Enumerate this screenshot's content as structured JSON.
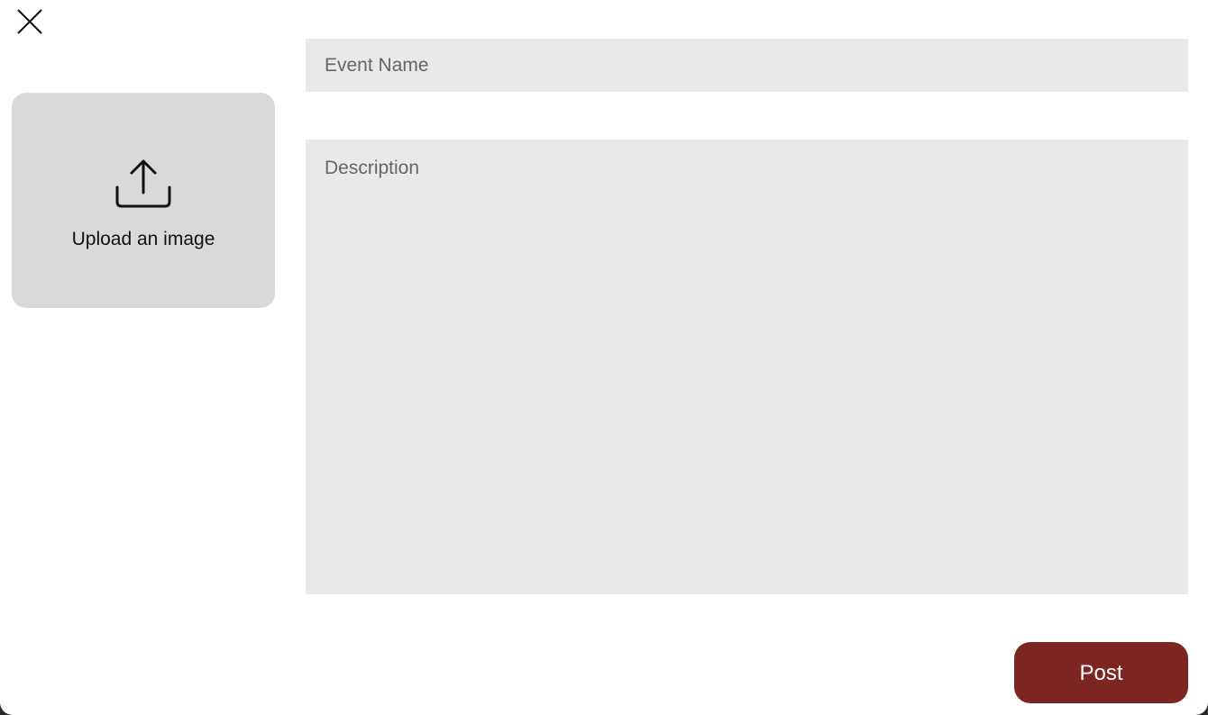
{
  "dialog": {
    "close_icon": "close-icon"
  },
  "upload": {
    "icon": "upload-icon",
    "label": "Upload an image"
  },
  "form": {
    "event_name_placeholder": "Event Name",
    "event_name_value": "",
    "description_placeholder": "Description",
    "description_value": ""
  },
  "actions": {
    "post_label": "Post",
    "post_color": "#7d2521"
  },
  "colors": {
    "field_background": "#e9e9e9",
    "upload_background": "#d9d9d9"
  }
}
